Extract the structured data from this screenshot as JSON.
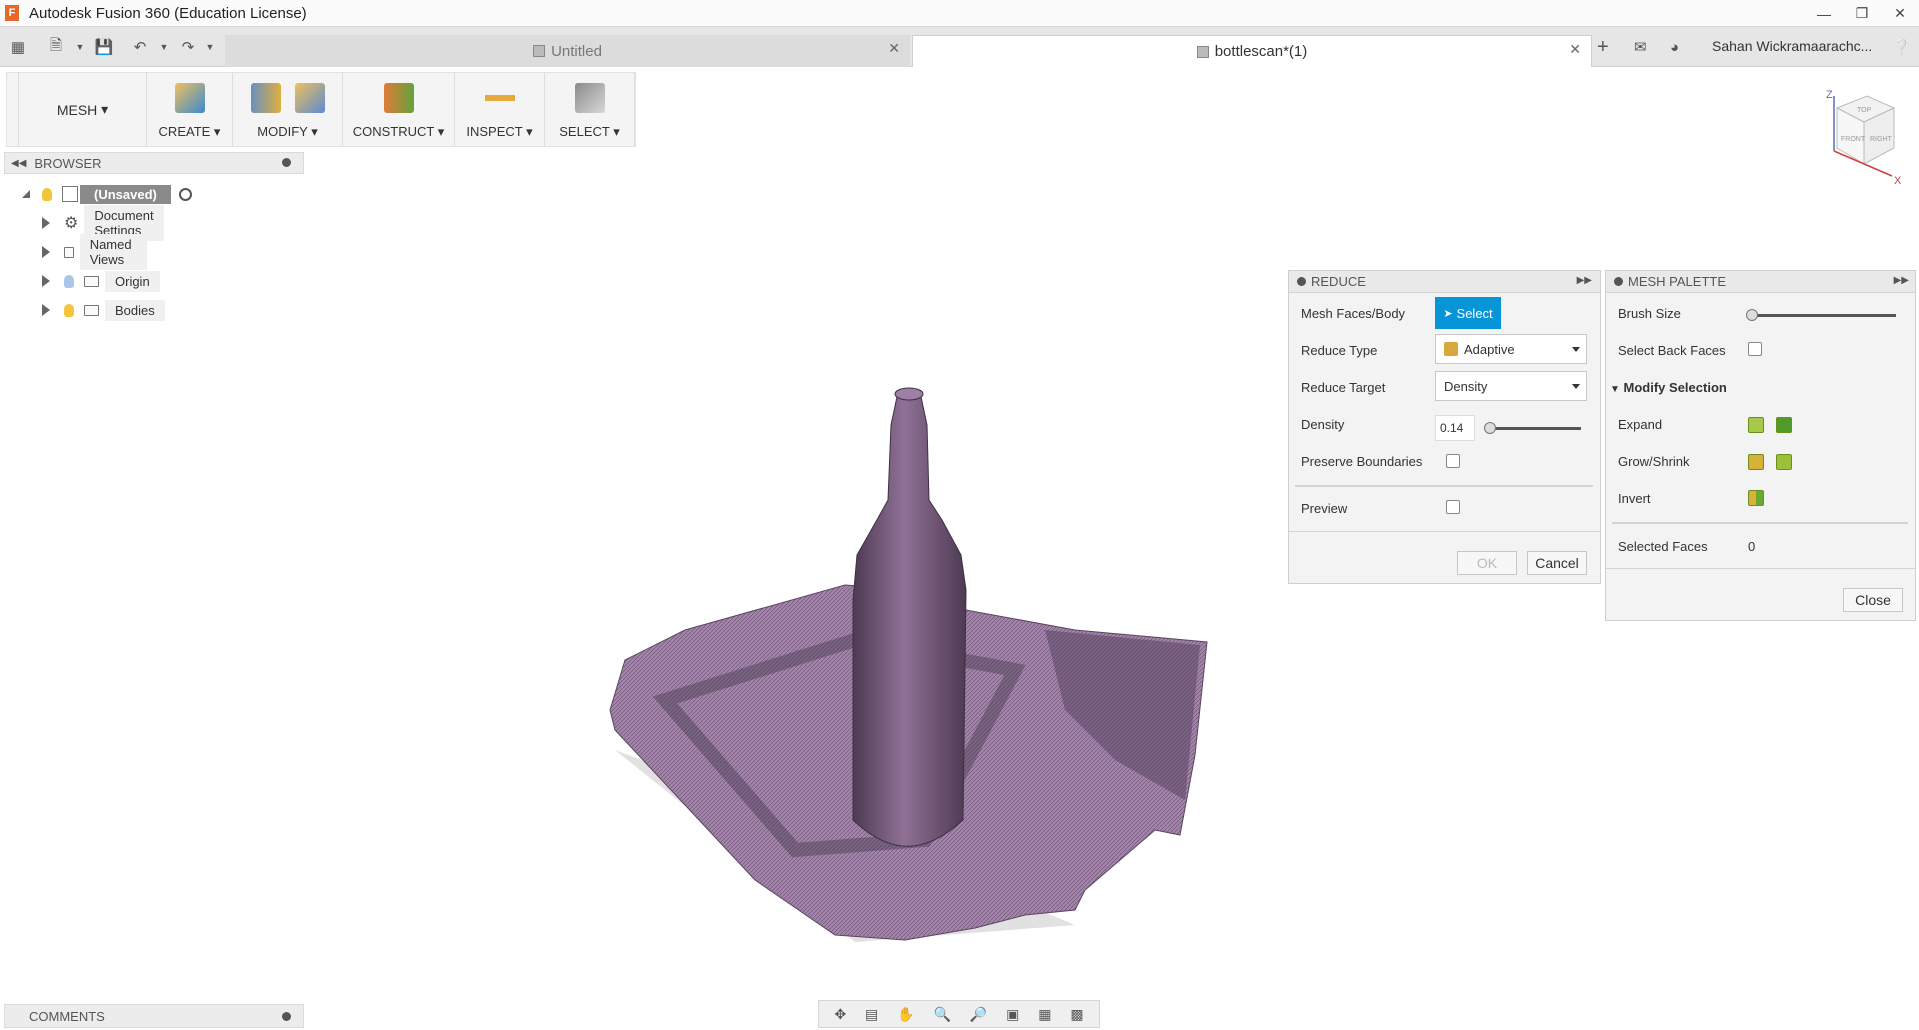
{
  "window": {
    "title": "Autodesk Fusion 360 (Education License)",
    "logo_letter": "F"
  },
  "tabs": [
    {
      "label": "Untitled",
      "active": false
    },
    {
      "label": "bottlescan*(1)",
      "active": true
    }
  ],
  "user": {
    "name": "Sahan Wickramaarachc..."
  },
  "toolbar": {
    "workspace": "MESH",
    "groups": {
      "create": "CREATE",
      "modify": "MODIFY",
      "construct": "CONSTRUCT",
      "inspect": "INSPECT",
      "select": "SELECT"
    }
  },
  "browser": {
    "title": "BROWSER",
    "root": "(Unsaved)",
    "items": [
      {
        "label": "Document Settings"
      },
      {
        "label": "Named Views"
      },
      {
        "label": "Origin"
      },
      {
        "label": "Bodies"
      }
    ]
  },
  "reduce": {
    "title": "REDUCE",
    "mesh_faces_label": "Mesh Faces/Body",
    "select_label": "Select",
    "reduce_type_label": "Reduce Type",
    "reduce_type_value": "Adaptive",
    "reduce_target_label": "Reduce Target",
    "reduce_target_value": "Density",
    "density_label": "Density",
    "density_value": "0.14",
    "density_fraction": 0.05,
    "preserve_label": "Preserve Boundaries",
    "preview_label": "Preview",
    "ok_label": "OK",
    "cancel_label": "Cancel"
  },
  "mesh_palette": {
    "title": "MESH PALETTE",
    "brush_size_label": "Brush Size",
    "brush_size_fraction": 0.0,
    "back_faces_label": "Select Back Faces",
    "modify_selection_label": "Modify Selection",
    "expand_label": "Expand",
    "grow_shrink_label": "Grow/Shrink",
    "invert_label": "Invert",
    "selected_faces_label": "Selected Faces",
    "selected_faces_value": "0",
    "close_label": "Close"
  },
  "viewcube": {
    "top": "TOP",
    "front": "FRONT",
    "right": "RIGHT",
    "z": "Z",
    "x": "X"
  },
  "comments": {
    "title": "COMMENTS"
  },
  "colors": {
    "accent": "#0696d7",
    "mesh": "#a080a8",
    "mesh_dark": "#5a4560"
  }
}
